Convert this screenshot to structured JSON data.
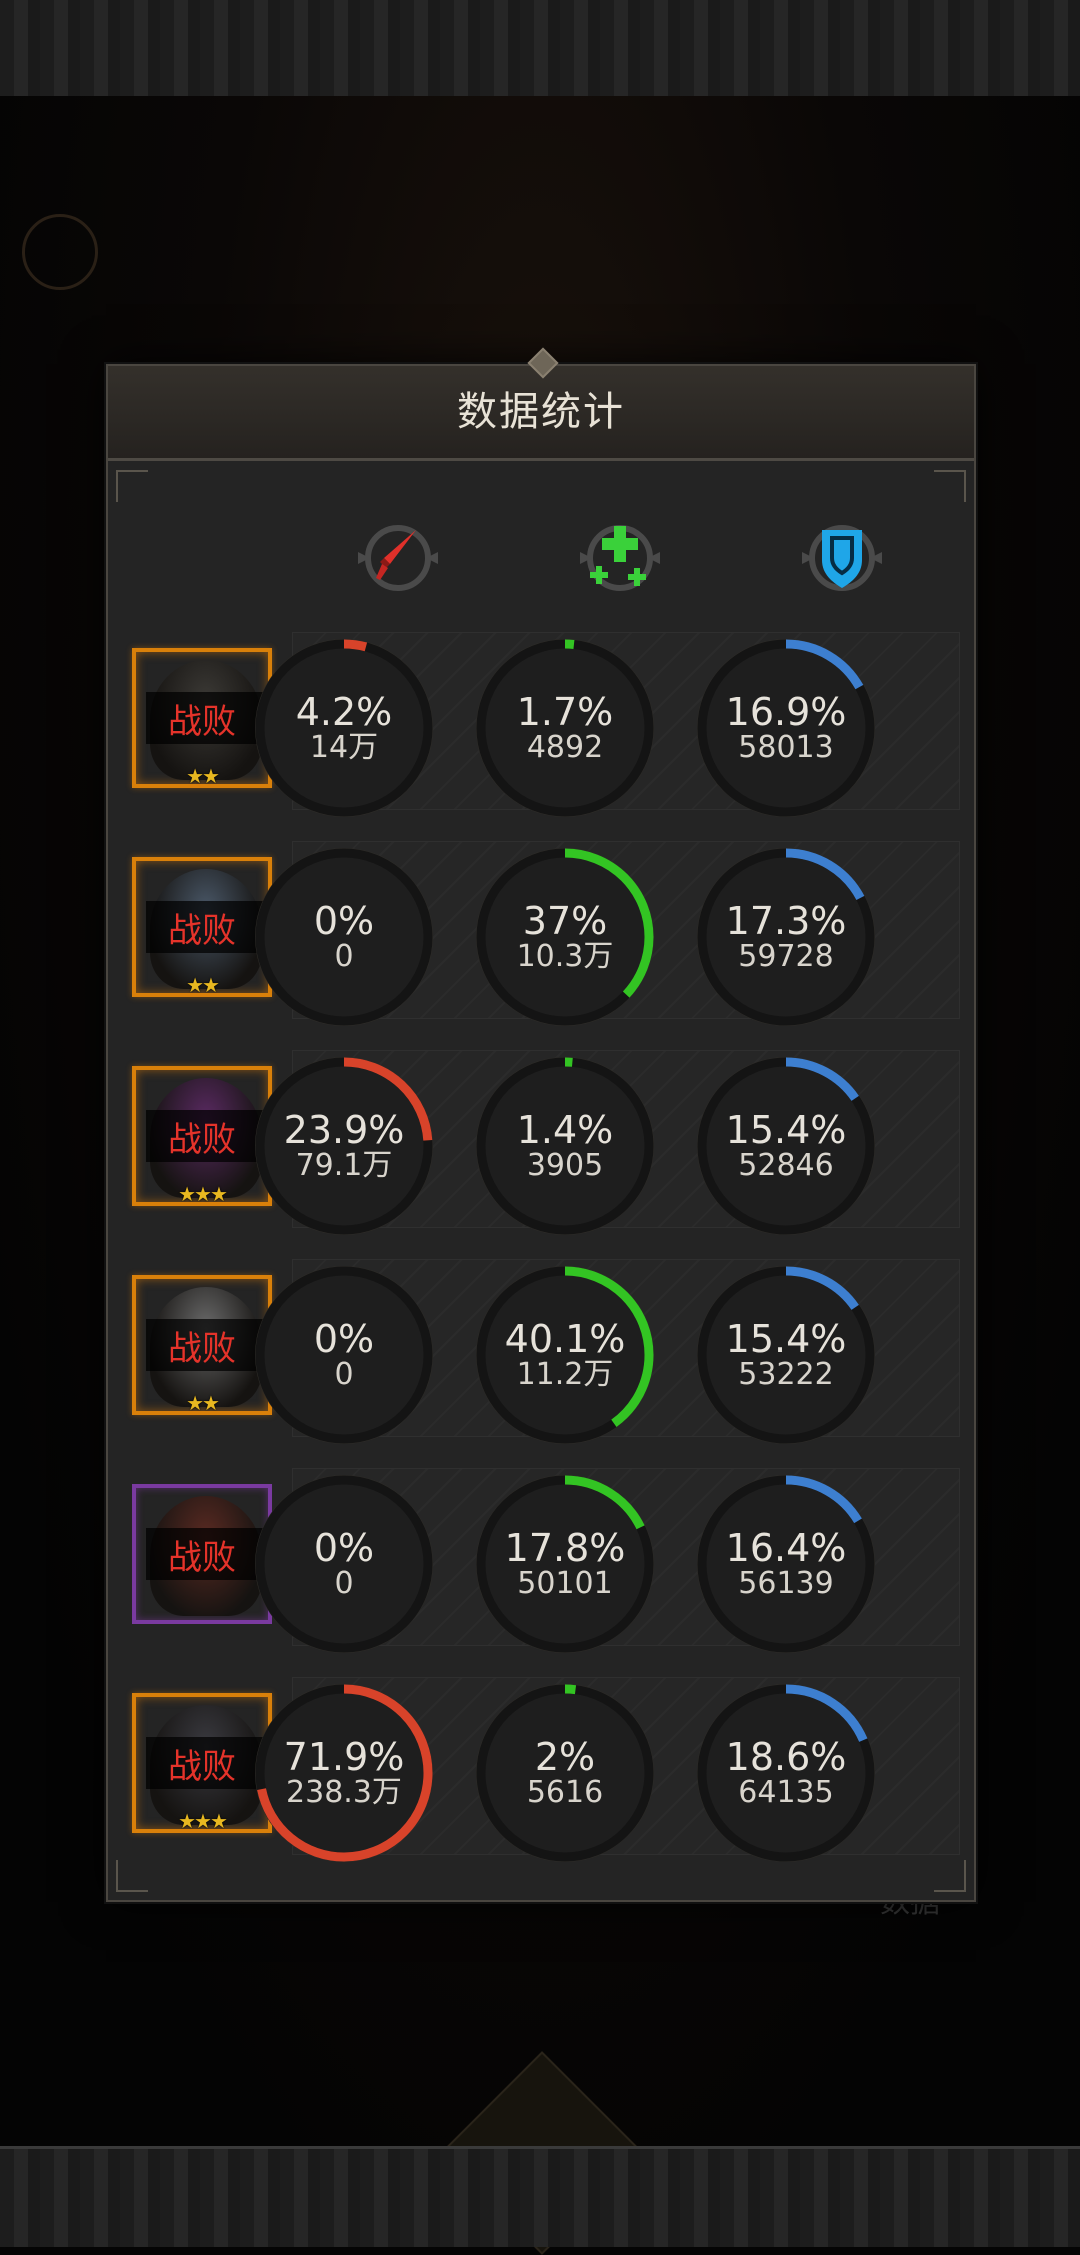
{
  "title": "数据统计",
  "background_caption": "数据",
  "columns": [
    {
      "icon": "damage-sword-icon",
      "color": "#d8322a"
    },
    {
      "icon": "heal-cross-icon",
      "color": "#39c22c"
    },
    {
      "icon": "shield-defense-icon",
      "color": "#2fa8e6"
    }
  ],
  "heroes": [
    {
      "status": "战败",
      "stars": "★★",
      "frame": "orange",
      "face": "#3c3a36",
      "damage": {
        "pct": "4.2%",
        "amount": "14万",
        "value": 4.2
      },
      "heal": {
        "pct": "1.7%",
        "amount": "4892",
        "value": 1.7
      },
      "tank": {
        "pct": "16.9%",
        "amount": "58013",
        "value": 16.9
      }
    },
    {
      "status": "战败",
      "stars": "★★",
      "frame": "orange",
      "face": "#4a5868",
      "damage": {
        "pct": "0%",
        "amount": "0",
        "value": 0
      },
      "heal": {
        "pct": "37%",
        "amount": "10.3万",
        "value": 37
      },
      "tank": {
        "pct": "17.3%",
        "amount": "59728",
        "value": 17.3
      }
    },
    {
      "status": "战败",
      "stars": "★★★",
      "frame": "orange",
      "face": "#5a2a62",
      "damage": {
        "pct": "23.9%",
        "amount": "79.1万",
        "value": 23.9
      },
      "heal": {
        "pct": "1.4%",
        "amount": "3905",
        "value": 1.4
      },
      "tank": {
        "pct": "15.4%",
        "amount": "52846",
        "value": 15.4
      }
    },
    {
      "status": "战败",
      "stars": "★★",
      "frame": "orange",
      "face": "#6a6a6a",
      "damage": {
        "pct": "0%",
        "amount": "0",
        "value": 0
      },
      "heal": {
        "pct": "40.1%",
        "amount": "11.2万",
        "value": 40.1
      },
      "tank": {
        "pct": "15.4%",
        "amount": "53222",
        "value": 15.4
      }
    },
    {
      "status": "战败",
      "stars": "",
      "frame": "purple",
      "face": "#5a2a22",
      "damage": {
        "pct": "0%",
        "amount": "0",
        "value": 0
      },
      "heal": {
        "pct": "17.8%",
        "amount": "50101",
        "value": 17.8
      },
      "tank": {
        "pct": "16.4%",
        "amount": "56139",
        "value": 16.4
      }
    },
    {
      "status": "战败",
      "stars": "★★★",
      "frame": "orange",
      "face": "#3a3a40",
      "damage": {
        "pct": "71.9%",
        "amount": "238.3万",
        "value": 71.9
      },
      "heal": {
        "pct": "2%",
        "amount": "5616",
        "value": 2
      },
      "tank": {
        "pct": "18.6%",
        "amount": "64135",
        "value": 18.6
      }
    }
  ],
  "colors": {
    "damage": "#d8432a",
    "heal": "#33c423",
    "tank": "#3d7fd0",
    "ring_track": "#141414",
    "panel": "#242424"
  }
}
